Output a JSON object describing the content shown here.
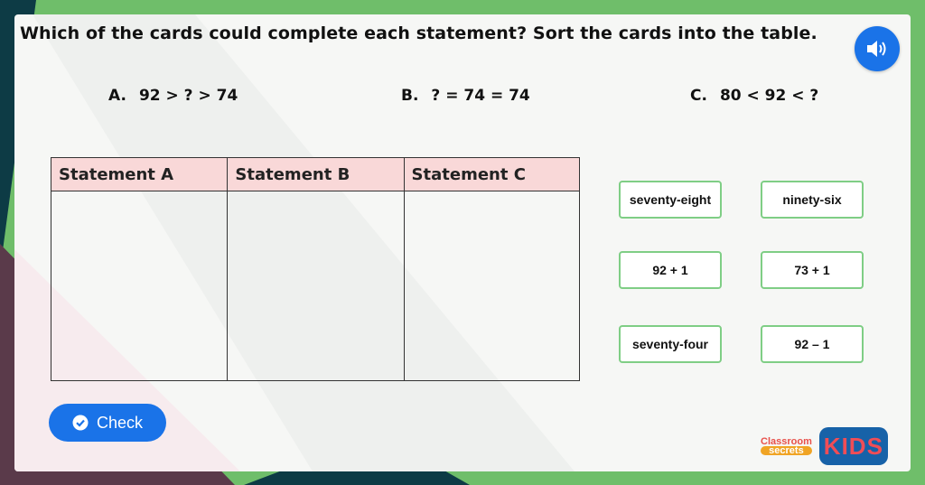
{
  "question": "Which of the cards could complete each statement? Sort the cards into the table.",
  "statements": [
    {
      "label": "A.",
      "text": "92 > ? > 74"
    },
    {
      "label": "B.",
      "text": "? = 74 = 74"
    },
    {
      "label": "C.",
      "text": "80 < 92 < ?"
    }
  ],
  "table": {
    "headers": [
      "Statement A",
      "Statement B",
      "Statement C"
    ]
  },
  "cards": [
    "seventy-eight",
    "ninety-six",
    "92 + 1",
    "73 + 1",
    "seventy-four",
    "92 – 1"
  ],
  "check_label": "Check",
  "logo": {
    "line1": "Classroom",
    "line2": "secrets",
    "kids": "KIDS"
  },
  "colors": {
    "accent": "#1a73e8",
    "header_fill": "#f9d8d8",
    "card_border": "#7fce85",
    "frame": "#6fbe6a"
  }
}
